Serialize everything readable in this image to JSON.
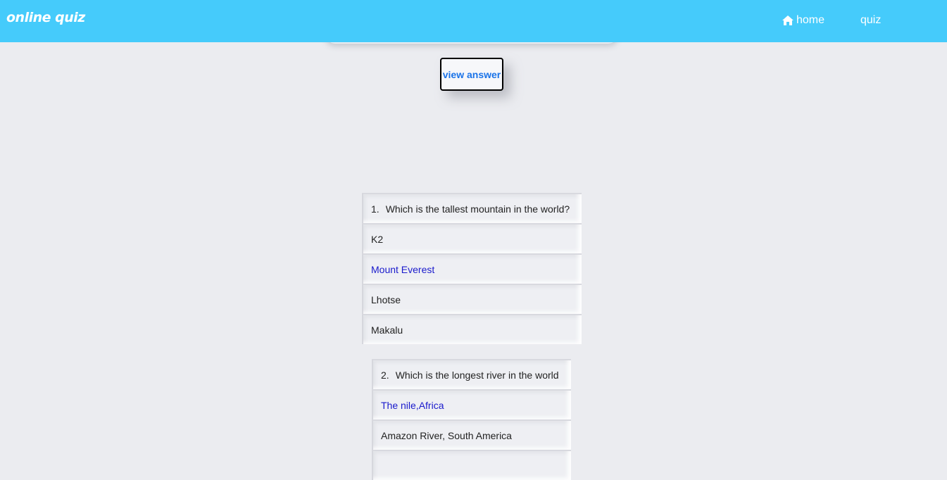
{
  "nav": {
    "brand": "online quiz",
    "home_label": "home",
    "quiz_label": "quiz",
    "home_icon": "home-icon"
  },
  "view_answer_label": "view answer",
  "colors": {
    "navbar": "#45cbfb",
    "background": "#ebecf0",
    "correct_answer": "#1a1acc",
    "button_text": "#1a73e8"
  },
  "questions": [
    {
      "number": "1.",
      "text": "Which is the tallest mountain in the world?",
      "options": [
        "K2",
        "Mount Everest",
        "Lhotse",
        "Makalu"
      ],
      "correct_index": 1
    },
    {
      "number": "2.",
      "text": "Which is the longest river in the world",
      "options": [
        "The nile,Africa",
        "Amazon River, South America"
      ],
      "correct_index": 0
    }
  ]
}
